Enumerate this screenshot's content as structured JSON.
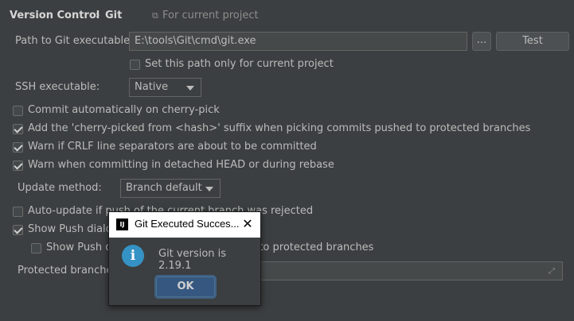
{
  "header": {
    "breadcrumb_root": "Version Control",
    "separator": "›",
    "breadcrumb_leaf": "Git",
    "scope_icon": "copy-icon",
    "scope_text": "For current project"
  },
  "git_path": {
    "label": "Path to Git executable:",
    "value": "E:\\tools\\Git\\cmd\\git.exe",
    "browse_label": "...",
    "test_label": "Test",
    "project_only_label": "Set this path only for current project",
    "project_only_checked": false
  },
  "ssh": {
    "label": "SSH executable:",
    "selected": "Native"
  },
  "options": {
    "commit_cherry_pick": {
      "label": "Commit automatically on cherry-pick",
      "checked": false
    },
    "add_suffix": {
      "label": "Add the 'cherry-picked from <hash>' suffix when picking commits pushed to protected branches",
      "checked": true
    },
    "warn_crlf": {
      "label": "Warn if CRLF line separators are about to be committed",
      "checked": true
    },
    "warn_detached": {
      "label": "Warn when committing in detached HEAD or during rebase",
      "checked": true
    }
  },
  "update": {
    "label": "Update method:",
    "selected": "Branch default"
  },
  "push": {
    "auto_update_label": "Auto-update if push of the current branch was rejected",
    "auto_update_checked": false,
    "show_push_dialog_label": "Show Push dialog for Commit and Push",
    "show_push_dialog_checked": true,
    "show_push_only_label": "Show Push dialog only when committing to protected branches",
    "show_push_only_checked": false,
    "protected_label": "Protected branches:",
    "protected_value": ""
  },
  "dialog": {
    "logo_text": "IJ",
    "title": "Git Executed Succes...",
    "close_glyph": "✕",
    "icon": "info-icon",
    "icon_glyph": "i",
    "message": "Git version is 2.19.1",
    "ok_label": "OK"
  },
  "colors": {
    "background": "#3c3f41",
    "accent_button": "#365880",
    "info_icon": "#3592c4"
  }
}
